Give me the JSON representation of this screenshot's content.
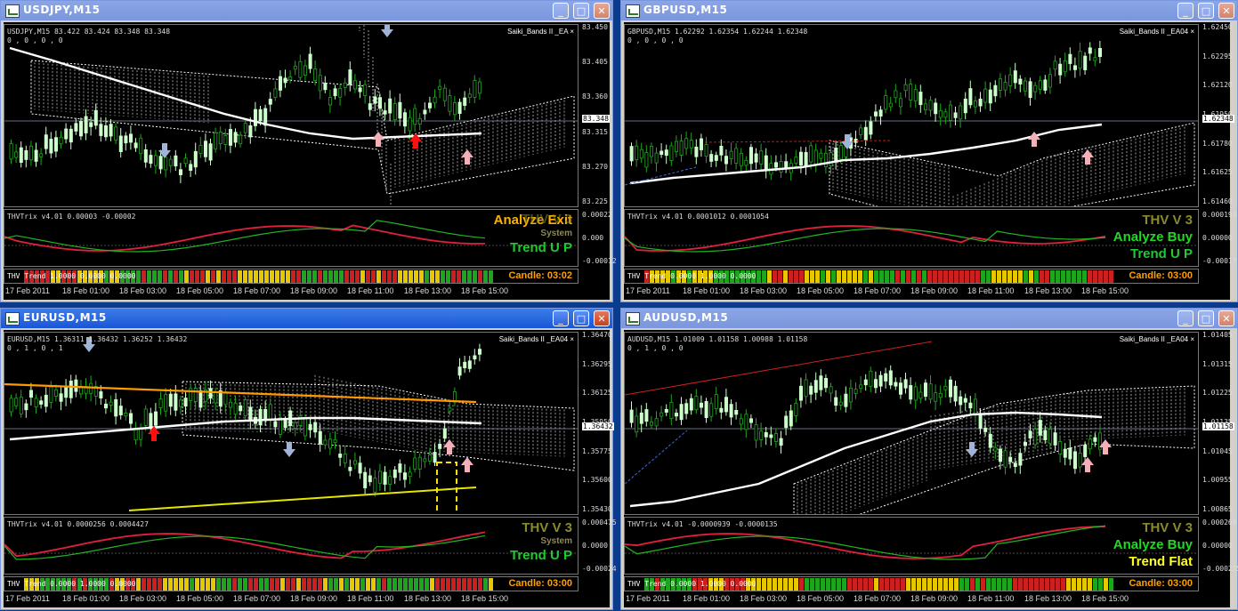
{
  "windows": [
    {
      "title": "USDJPY,M15",
      "header": "USDJPY,M15  83.422 83.424 83.348 83.348",
      "sub": "0 , 0 , 0 , 0",
      "ea": "Saiki_Bands II _EA",
      "yaxis": [
        "83.450",
        "83.405",
        "83.360",
        "83.315",
        "83.270",
        "83.225"
      ],
      "current_price": "83.348",
      "ind_header": "THVTrix v4.01 0.00003 -0.00002",
      "ind_axis": [
        "0.00022",
        "0.000",
        "-0.00012"
      ],
      "status_lines": [
        {
          "text": "Analyze Exit",
          "color": "#ffb000"
        },
        {
          "text": "System",
          "color": "#8a8a5a"
        },
        {
          "text": "Trend U P",
          "color": "#22c832"
        }
      ],
      "big_label": "THV V 3",
      "trend_header": "THV Trend 1.0000 0.0000 0.0000",
      "candle": "Candle:  03:02"
    },
    {
      "title": "GBPUSD,M15",
      "header": "GBPUSD,M15  1.62292 1.62354 1.62244 1.62348",
      "sub": "0 , 0 , 0 , 0",
      "ea": "Saiki_Bands II _EA04",
      "yaxis": [
        "1.62450",
        "1.62295",
        "1.62120",
        "1.61950",
        "1.61780",
        "1.61625",
        "1.61460"
      ],
      "current_price": "1.62348",
      "ind_header": "THVTrix v4.01 0.0001012 0.0001054",
      "ind_axis": [
        "0.000192",
        "0.00000",
        "-0.00017"
      ],
      "status_lines": [
        {
          "text": "THV V 3",
          "color": "#8a8a2a"
        },
        {
          "text": "Analyze Buy",
          "color": "#22d822"
        },
        {
          "text": "Trend U P",
          "color": "#22c832"
        }
      ],
      "trend_header": "THV Trend 0.0000 1.0000 0.0000",
      "candle": "Candle:  03:00"
    },
    {
      "title": "EURUSD,M15",
      "header": "EURUSD,M15  1.36311 1.36432 1.36252 1.36432",
      "sub": "0 , 1 , 0 , 1",
      "ea": "Saiki_Bands II _EA04",
      "yaxis": [
        "1.36470",
        "1.36295",
        "1.36125",
        "1.35950",
        "1.35775",
        "1.35600",
        "1.35430"
      ],
      "current_price": "1.36432",
      "ind_header": "THVTrix v4.01 0.0000256 0.0004427",
      "ind_axis": [
        "0.000475",
        "0.0000",
        "-0.00024"
      ],
      "status_lines": [
        {
          "text": "THV V 3",
          "color": "#8a8a2a"
        },
        {
          "text": "System",
          "color": "#8a8a5a"
        },
        {
          "text": "Trend U P",
          "color": "#22c832"
        }
      ],
      "trend_header": "THV Trend 0.0000 1.0000 0.0000",
      "candle": "Candle:  03:00"
    },
    {
      "title": "AUDUSD,M15",
      "header": "AUDUSD,M15  1.01009 1.01158 1.00988 1.01158",
      "sub": "0 , 1 , 0 , 0",
      "ea": "Saiki_Bands II _EA04",
      "yaxis": [
        "1.01405",
        "1.01315",
        "1.01225",
        "1.01135",
        "1.01045",
        "1.00955",
        "1.00865"
      ],
      "current_price": "1.01158",
      "ind_header": "THVTrix v4.01 -0.0000939 -0.0000135",
      "ind_axis": [
        "0.000268",
        "0.00000",
        "-0.000235"
      ],
      "status_lines": [
        {
          "text": "THV V 3",
          "color": "#8a8a2a"
        },
        {
          "text": "Analyze Buy",
          "color": "#22d822"
        },
        {
          "text": "Trend Flat",
          "color": "#ffff20"
        }
      ],
      "trend_header": "THV Trend 0.0000 1.0000 0.0000",
      "candle": "Candle:  03:00"
    }
  ],
  "time_axis": [
    "17 Feb 2011",
    "18 Feb 01:00",
    "18 Feb 03:00",
    "18 Feb 05:00",
    "18 Feb 07:00",
    "18 Feb 09:00",
    "18 Feb 11:00",
    "18 Feb 13:00",
    "18 Feb 15:00"
  ],
  "window_buttons": {
    "minimize": "_",
    "maximize": "□",
    "close": "✕"
  },
  "colors": {
    "bull": "#ccffcc",
    "bear": "#1ea51e",
    "ma": "#ffffff",
    "trix_red": "#e0203c",
    "trix_green": "#22b822",
    "orange_line": "#ff9a00",
    "yellow_line": "#e6e600",
    "sell_arrow": "#9fb4d8",
    "buy_arrow": "#f4b0b8",
    "strong_buy": "#ff1010"
  }
}
